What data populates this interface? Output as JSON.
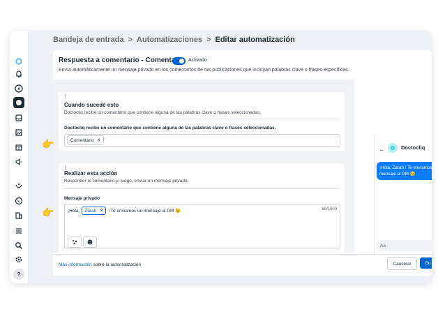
{
  "breadcrumb": {
    "items": [
      "Bandeja de entrada",
      "Automatizaciones",
      "Editar automatización"
    ],
    "separator": ">"
  },
  "panel": {
    "title": "Respuesta a comentario - Comentario",
    "toggle_status": "Activado",
    "description": "Envía automáticamente un mensaje privado en los comentarios de tus publicaciones que incluyan palabras clave o frases específicas."
  },
  "trigger": {
    "heading": "Cuando sucede esto",
    "subtext": "Doctocliq recibe un comentario que contiene alguna de las palabras clave o frases seleccionadas.",
    "field_label": "Doctocliq recibe un comentario que contiene alguna de las palabras clave o frases seleccionadas.",
    "keyword_chip": "Comentario",
    "chip_remove": "✕"
  },
  "action": {
    "heading": "Realizar esta acción",
    "subtext": "Responder el comentario y, luego, enviar un mensaje privado.",
    "field_label": "Mensaje privado",
    "message_prefix": "¡Hola,",
    "variable_chip": "Zarah",
    "chip_remove": "✕",
    "message_suffix": "! Te enviamos un mensaje al DM 😉",
    "char_count": "60/1000"
  },
  "footer": {
    "more_link": "Más información",
    "more_text": "sobre la automatización",
    "cancel_label": "Cancelar",
    "primary_label": "Gu"
  },
  "preview": {
    "back": "←",
    "name": "Doctocliq",
    "bubble_text": "¡Hola, Zarah ! Te enviamos un mensaje al DM 😉",
    "input_placeholder": "Aa"
  },
  "colors": {
    "accent": "#0064d1",
    "bubble": "#0a7cff",
    "background": "#eef1f5"
  },
  "icons": [
    "meta-logo-icon",
    "home-icon",
    "notifications-icon",
    "compass-icon",
    "chat-icon",
    "inbox-icon",
    "image-icon",
    "calendar-icon",
    "megaphone-icon",
    "routing-icon",
    "whatsapp-icon",
    "building-icon",
    "menu-icon",
    "search-icon",
    "settings-icon",
    "help-icon",
    "pointing-hand-icon",
    "sparkle-icon",
    "emoji-icon"
  ]
}
